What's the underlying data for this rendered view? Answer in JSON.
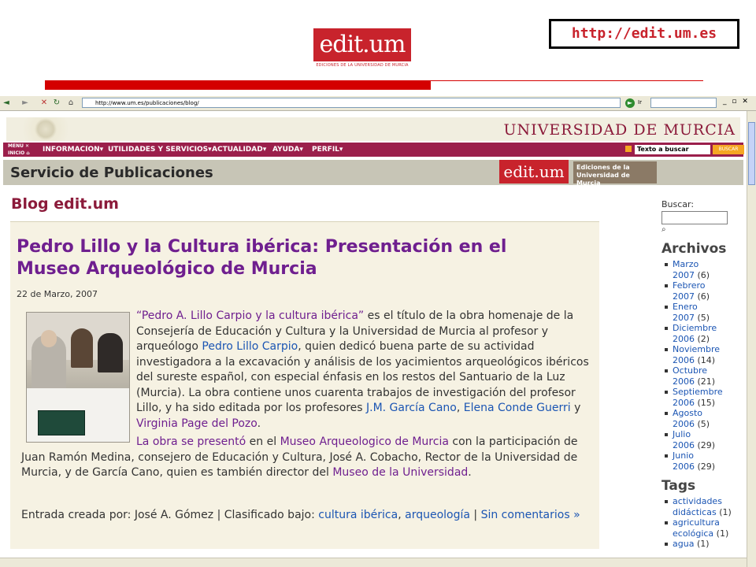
{
  "slide": {
    "logo_text": "edit.um",
    "logo_subtitle": "EDICIONES DE LA UNIVERSIDAD DE MURCIA",
    "url": "http://edit.um.es"
  },
  "browser": {
    "address": "http://www.um.es/publicaciones/blog/",
    "go_label": "Ir"
  },
  "um_header": {
    "title": "UNIVERSIDAD DE MURCIA",
    "menu_label": "MENU",
    "inicio_label": "INICIO",
    "nav": [
      "INFORMACION",
      "UTILIDADES Y SERVICIOS",
      "ACTUALIDAD",
      "AYUDA",
      "PERFIL"
    ],
    "search_placeholder": "Texto a buscar",
    "search_button": "BUSCAR"
  },
  "service": {
    "title": "Servicio de Publicaciones",
    "logo_text": "edit.um",
    "logo_sub": "Ediciones de la Universidad de Murcia"
  },
  "blog": {
    "title": "Blog edit.um"
  },
  "post": {
    "title": "Pedro Lillo y la Cultura ibérica: Presentación en el Museo Arqueológico de Murcia",
    "date": "22 de Marzo, 2007",
    "p1": {
      "link1": "“Pedro A. Lillo Carpio y la cultura ibérica”",
      "t1": " es el título de la obra homenaje de la Consejería de Educación y Cultura y la Universidad de Murcia al profesor y arqueólogo ",
      "link2": "Pedro Lillo Carpio",
      "t2": ", quien dedicó buena parte de su actividad investigadora a la excavación y análisis de los yacimientos arqueológicos ibéricos del sureste español, con especial énfasis en los restos del Santuario de la Luz (Murcia). La obra contiene unos cuarenta trabajos de investigación del profesor Lillo, y ha sido editada por los profesores ",
      "link3": "J.M. García Cano",
      "t3": ", ",
      "link4": "Elena Conde Guerri",
      "t4": " y ",
      "link5": "Virginia Page del Pozo",
      "t5": "."
    },
    "p2": {
      "link1": "La obra se presentó",
      "t1": " en el ",
      "link2": "Museo Arqueologico de Murcia",
      "t2": " con la participación de Juan Ramón Medina, consejero de Educación y Cultura, José A. Cobacho, Rector de la Universidad de Murcia, y de García Cano, quien es también director del ",
      "link3": "Museo de la Universidad",
      "t3": "."
    },
    "footer": {
      "t1": "Entrada creada por: José A. Gómez | Clasificado bajo: ",
      "cat1": "cultura ibérica",
      "sep1": ", ",
      "cat2": "arqueología",
      "sep2": " | ",
      "comments": "Sin comentarios »"
    }
  },
  "sidebar": {
    "buscar_label": "Buscar:",
    "archivos_title": "Archivos",
    "archives": [
      {
        "month": "Marzo",
        "year": "2007",
        "count": "(6)"
      },
      {
        "month": "Febrero",
        "year": "2007",
        "count": "(6)"
      },
      {
        "month": "Enero",
        "year": "2007",
        "count": "(5)"
      },
      {
        "month": "Diciembre",
        "year": "2006",
        "count": "(2)"
      },
      {
        "month": "Noviembre",
        "year": "2006",
        "count": "(14)"
      },
      {
        "month": "Octubre",
        "year": "2006",
        "count": "(21)"
      },
      {
        "month": "Septiembre",
        "year": "2006",
        "count": "(15)"
      },
      {
        "month": "Agosto",
        "year": "2006",
        "count": "(5)"
      },
      {
        "month": "Julio",
        "year": "2006",
        "count": "(29)"
      },
      {
        "month": "Junio",
        "year": "2006",
        "count": "(29)"
      }
    ],
    "tags_title": "Tags",
    "tags": [
      {
        "a": "actividades",
        "b": "didácticas",
        "count": "(1)"
      },
      {
        "a": "agricultura",
        "b": "ecológica",
        "count": "(1)"
      },
      {
        "a": "agua",
        "b": "",
        "count": "(1)"
      }
    ]
  },
  "colors": {
    "brand_red": "#c8232c",
    "nav_bg": "#9b1f4b",
    "title_purple": "#6f1f8f",
    "link_blue": "#1b55b3"
  }
}
